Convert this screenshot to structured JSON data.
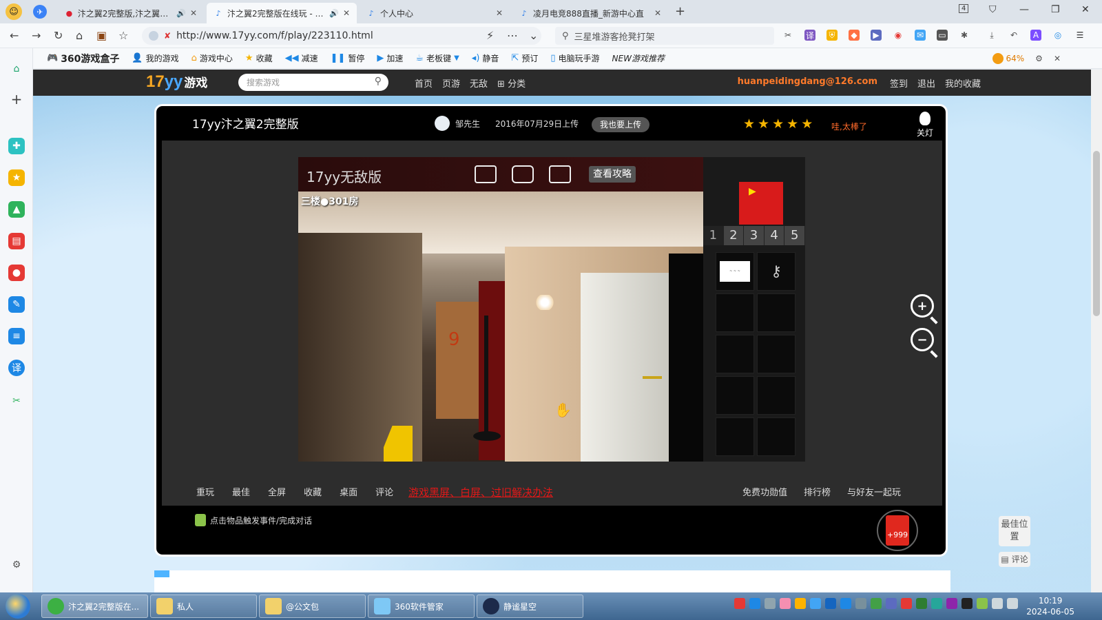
{
  "browser": {
    "tabs": [
      {
        "label": "汴之翼2完整版,汴之翼2完整",
        "icon": "map-pin-icon"
      },
      {
        "label": "汴之翼2完整版在线玩 - 17",
        "icon": "game-tab-icon",
        "active": true
      },
      {
        "label": "个人中心",
        "icon": "game-tab-icon"
      },
      {
        "label": "凌月电竞888直播_新游中心直",
        "icon": "game-tab-icon"
      }
    ],
    "url": "http://www.17yy.com/f/play/223110.html",
    "search_placeholder": "三星堆游客抢凳打架",
    "tab_count": "4",
    "bookmarks": [
      {
        "label": "360游戏盒子",
        "icon": "gamepad-icon"
      },
      {
        "label": "我的游戏",
        "icon": "user-icon"
      },
      {
        "label": "游戏中心",
        "icon": "home-icon"
      },
      {
        "label": "收藏",
        "icon": "star-icon"
      },
      {
        "label": "减速",
        "icon": "rewind-icon"
      },
      {
        "label": "暂停",
        "icon": "pause-icon"
      },
      {
        "label": "加速",
        "icon": "forward-icon"
      },
      {
        "label": "老板键",
        "icon": "boss-key-icon"
      },
      {
        "label": "静音",
        "icon": "mute-icon"
      },
      {
        "label": "预订",
        "icon": "reserve-icon"
      },
      {
        "label": "电脑玩手游",
        "icon": "phone-icon"
      },
      {
        "label": "NEW游戏推荐",
        "icon": "new-badge-icon"
      }
    ],
    "battery": "64%"
  },
  "site": {
    "logo_num": "17",
    "logo_yy": "yy",
    "logo_text": "游戏",
    "search_placeholder": "搜索游戏",
    "nav": [
      "首页",
      "页游",
      "无敌",
      "分类"
    ],
    "user_email": "huanpeidingdang@126.com",
    "links": [
      "签到",
      "退出",
      "我的收藏"
    ]
  },
  "game": {
    "title": "17yy汴之翼2完整版",
    "uploader": "邹先生",
    "upload_date": "2016年07月29日上传",
    "upload_btn": "我也要上传",
    "rating": 5,
    "rating_text": "哇,太棒了",
    "light_label": "关灯",
    "canvas_title": "17yy无敌版",
    "strategy_btn": "查看攻略",
    "room_label": "三楼●301房",
    "floor_tabs": [
      "1",
      "2",
      "3",
      "4",
      "5"
    ],
    "bottom_links": [
      "重玩",
      "最佳",
      "全屏",
      "收藏",
      "桌面",
      "评论"
    ],
    "warning_link": "游戏黑屏、白屏、过旧解决办法",
    "right_links": [
      "免费功勋值",
      "排行榜",
      "与好友一起玩"
    ],
    "hint": "点击物品触发事件/完成对话",
    "reward": "+999"
  },
  "side_buttons": [
    "最佳位置",
    "评论"
  ],
  "taskbar": {
    "tasks": [
      "汴之翼2完整版在...",
      "私人",
      "@公文包",
      "360软件管家",
      "静谧星空"
    ],
    "time": "10:19",
    "date": "2024-06-05"
  },
  "colors": {
    "accent_orange": "#ff7a2a",
    "warning_red": "#e01818",
    "star_yellow": "#f5b400"
  }
}
